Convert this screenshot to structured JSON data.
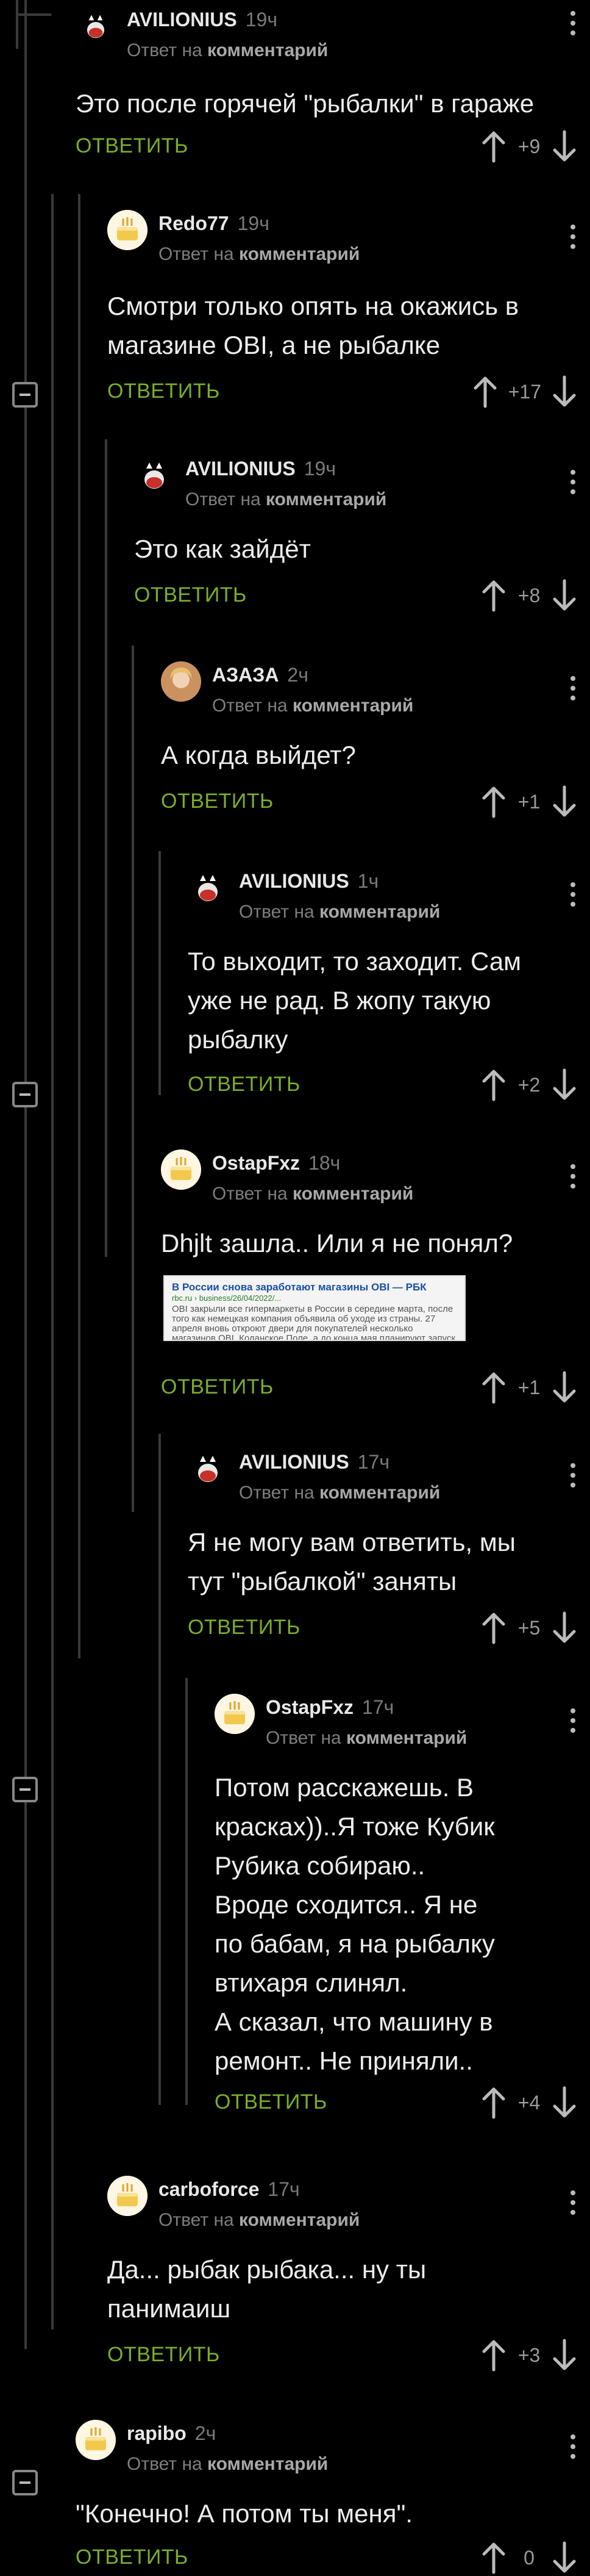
{
  "reply_label": "ОТВЕТИТЬ",
  "reply_prefix": "Ответ на",
  "reply_target": "комментарий",
  "link_preview": {
    "title": "В России снова заработают магазины OBI — РБК",
    "url": "rbc.ru › business/26/04/2022/...",
    "body": "OBI закрыли все гипермаркеты в России в середине марта, после того как немецкая компания объявила об уходе из страны. 27 апреля вновь откроют двери для покупателей несколько магазинов OBI. Коданское Поле, а до конца мая планируют запуск всех гипермаркетов сети."
  },
  "comments": [
    {
      "author": "AVILIONIUS",
      "time": "19ч",
      "text": "Это после горячей \"рыбалки\" в гараже",
      "votes": "+9",
      "avatar": "cat"
    },
    {
      "author": "Redo77",
      "time": "19ч",
      "text": "Смотри только опять на окажись в\nмагазине OBI, а не рыбалке",
      "votes": "+17",
      "avatar": "cake"
    },
    {
      "author": "AVILIONIUS",
      "time": "19ч",
      "text": "Это как зайдёт",
      "votes": "+8",
      "avatar": "cat"
    },
    {
      "author": "АЗАЗА",
      "time": "2ч",
      "text": "А когда выйдет?",
      "votes": "+1",
      "avatar": "girl"
    },
    {
      "author": "AVILIONIUS",
      "time": "1ч",
      "text": "То выходит, то заходит. Сам\nуже не рад. В жопу такую\nрыбалку",
      "votes": "+2",
      "avatar": "cat"
    },
    {
      "author": "OstapFxz",
      "time": "18ч",
      "text": "Dhjlt зашла.. Или я не понял?",
      "votes": "+1",
      "avatar": "cake"
    },
    {
      "author": "AVILIONIUS",
      "time": "17ч",
      "text": "Я не могу вам ответить, мы\nтут \"рыбалкой\" заняты",
      "votes": "+5",
      "avatar": "cat"
    },
    {
      "author": "OstapFxz",
      "time": "17ч",
      "text": "Потом расскажешь. В\nкрасках))..Я тоже Кубик\nРубика собираю..\nВроде сходится.. Я не\nпо бабам, я на рыбалку\nвтихаря слинял.\nА сказал, что машину в\nремонт.. Не приняли..",
      "votes": "+4",
      "avatar": "cake"
    },
    {
      "author": "carboforce",
      "time": "17ч",
      "text": "Да... рыбак рыбака... ну ты\nпанимаиш",
      "votes": "+3",
      "avatar": "cake"
    },
    {
      "author": "rapibo",
      "time": "2ч",
      "text": "\"Конечно! А потом ты меня\".",
      "votes": "0",
      "avatar": "cake"
    }
  ]
}
